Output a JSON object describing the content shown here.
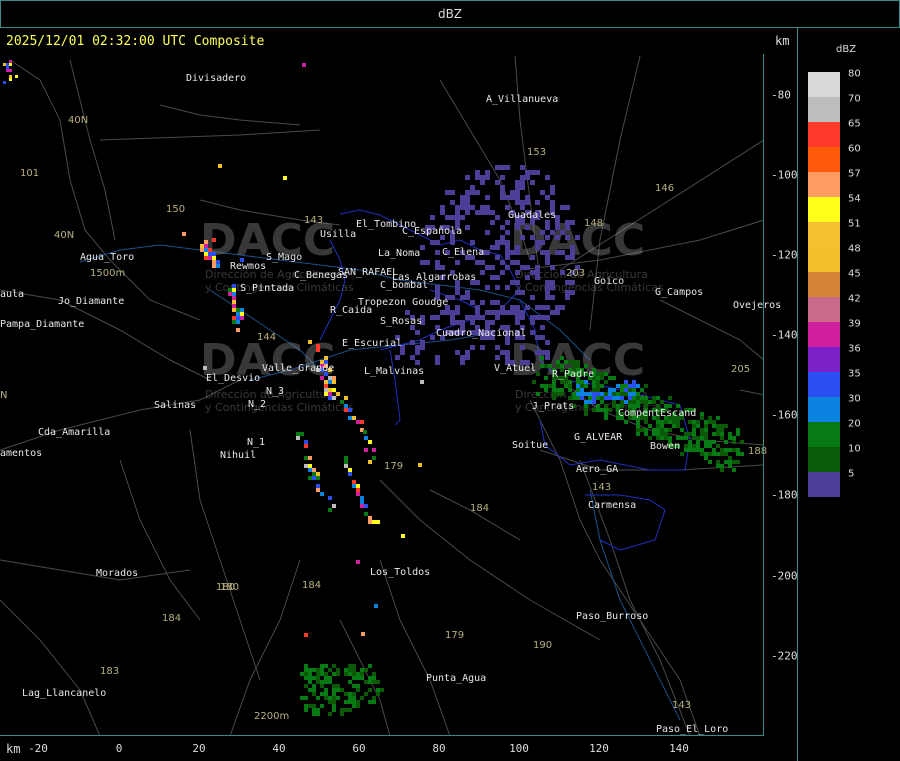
{
  "window": {
    "title": "dBZ"
  },
  "header": {
    "timestamp_label": "2025/12/01 02:32:00 UTC Composite",
    "km_unit": "km"
  },
  "axes": {
    "x_unit": "km",
    "x_ticks": [
      "-20",
      "0",
      "20",
      "40",
      "60",
      "80",
      "100",
      "120",
      "140"
    ],
    "y_ticks": [
      "-80",
      "-100",
      "-120",
      "-140",
      "-160",
      "-180",
      "-200",
      "-220"
    ]
  },
  "legend": {
    "title": "dBZ",
    "items": [
      {
        "label": "80",
        "color": "#d9d9d9"
      },
      {
        "label": "70",
        "color": "#bdbdbd"
      },
      {
        "label": "65",
        "color": "#ff3a2a"
      },
      {
        "label": "60",
        "color": "#ff5a0a"
      },
      {
        "label": "57",
        "color": "#ff9a60"
      },
      {
        "label": "54",
        "color": "#ffff1a"
      },
      {
        "label": "51",
        "color": "#f5c030"
      },
      {
        "label": "48",
        "color": "#f3be2b"
      },
      {
        "label": "45",
        "color": "#d6843a"
      },
      {
        "label": "42",
        "color": "#c86a88"
      },
      {
        "label": "39",
        "color": "#d020a0"
      },
      {
        "label": "36",
        "color": "#7a22c8"
      },
      {
        "label": "35",
        "color": "#2a4ff0"
      },
      {
        "label": "30",
        "color": "#0a82e0"
      },
      {
        "label": "20",
        "color": "#087a14"
      },
      {
        "label": "10",
        "color": "#0a5a0a"
      },
      {
        "label": "5",
        "color": "#4a3e96"
      }
    ]
  },
  "places": [
    {
      "name": "Divisadero"
    },
    {
      "name": "A_Villanueva"
    },
    {
      "name": "Guadales"
    },
    {
      "name": "El_Tombino"
    },
    {
      "name": "Usilla"
    },
    {
      "name": "C_Española"
    },
    {
      "name": "C_Elena"
    },
    {
      "name": "La_Noma"
    },
    {
      "name": "Agua_Toro"
    },
    {
      "name": "Rewmos"
    },
    {
      "name": "S_Mago"
    },
    {
      "name": "SAN_RAFAEL"
    },
    {
      "name": "C_Benegas"
    },
    {
      "name": "Las_Algarrobas"
    },
    {
      "name": "C_bombal"
    },
    {
      "name": "Goico"
    },
    {
      "name": "G_Campos"
    },
    {
      "name": "S_Pintada"
    },
    {
      "name": "Tropezon Goudge"
    },
    {
      "name": "R_Caida"
    },
    {
      "name": "S_Rosas"
    },
    {
      "name": "Ovejeros"
    },
    {
      "name": "Cuadro_Nacional"
    },
    {
      "name": "Pampa_Diamante"
    },
    {
      "name": "E_Escurial"
    },
    {
      "name": "El_Desvio"
    },
    {
      "name": "Valle_Grande"
    },
    {
      "name": "L_Malvinas"
    },
    {
      "name": "V_Atuel"
    },
    {
      "name": "R_Padre"
    },
    {
      "name": "Salinas"
    },
    {
      "name": "N_1"
    },
    {
      "name": "N_2"
    },
    {
      "name": "N_3"
    },
    {
      "name": "J_Prats"
    },
    {
      "name": "CompentEscand"
    },
    {
      "name": "G_ALVEAR"
    },
    {
      "name": "Bowen"
    },
    {
      "name": "Cda_Amarilla"
    },
    {
      "name": "amentos"
    },
    {
      "name": "Nihuil"
    },
    {
      "name": "Soitue"
    },
    {
      "name": "Aero_GA"
    },
    {
      "name": "Carmensa"
    },
    {
      "name": "Morados"
    },
    {
      "name": "Los_Toldos"
    },
    {
      "name": "Paso_Burroso"
    },
    {
      "name": "Punta_Agua"
    },
    {
      "name": "Lag_Llancanelo"
    },
    {
      "name": "Paso_El_Loro"
    },
    {
      "name": "aula"
    },
    {
      "name": "Jo_Diamante"
    }
  ],
  "routes": [
    "40N",
    "40N",
    "101",
    "150",
    "143",
    "153",
    "146",
    "148",
    "203",
    "144",
    "180",
    "179",
    "184",
    "184",
    "180",
    "184",
    "183",
    "179",
    "190",
    "143",
    "143",
    "205",
    "188",
    "1500m",
    "2200m",
    "N"
  ],
  "watermark": {
    "brand": "DACC",
    "line1": "Dirección de Agricultura",
    "line2": "y Contingencias Climáticas"
  },
  "echo_colors": {
    "dbz5": "#4a3e96",
    "dbz10": "#0a5a0a",
    "dbz20": "#087a14",
    "dbz30": "#0a82e0",
    "dbz35": "#2a4ff0",
    "dbz39": "#d020a0",
    "dbz48": "#f3be2b",
    "dbz54": "#ffff1a",
    "dbz57": "#ff9a60",
    "dbz65": "#ff3a2a",
    "dbz70": "#bdbdbd"
  }
}
